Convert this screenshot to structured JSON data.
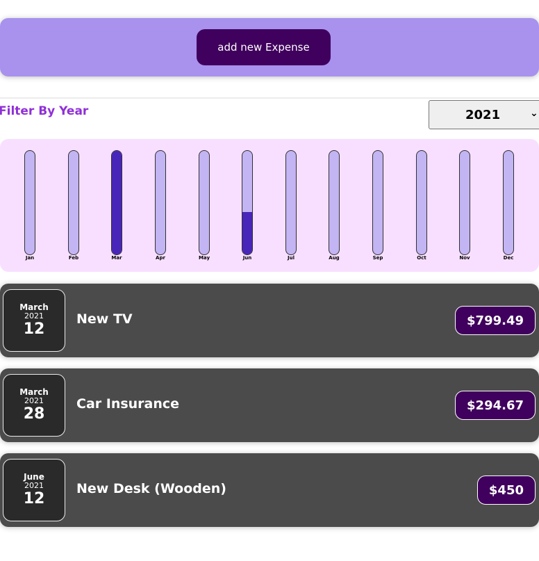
{
  "new_expense": {
    "button_label": "add new Expense"
  },
  "filter": {
    "label": "Filter By Year",
    "selected_year": "2021"
  },
  "chart_data": {
    "type": "bar",
    "categories": [
      "Jan",
      "Feb",
      "Mar",
      "Apr",
      "May",
      "Jun",
      "Jul",
      "Aug",
      "Sep",
      "Oct",
      "Nov",
      "Dec"
    ],
    "values": [
      0,
      0,
      1094.16,
      0,
      0,
      450,
      0,
      0,
      0,
      0,
      0,
      0
    ],
    "ylim": [
      0,
      1094.16
    ]
  },
  "expenses": [
    {
      "month": "March",
      "year": "2021",
      "day": "12",
      "title": "New TV",
      "amount": "$799.49"
    },
    {
      "month": "March",
      "year": "2021",
      "day": "28",
      "title": "Car Insurance",
      "amount": "$294.67"
    },
    {
      "month": "June",
      "year": "2021",
      "day": "12",
      "title": "New Desk (Wooden)",
      "amount": "$450"
    }
  ],
  "colors": {
    "accent": "#40005d",
    "filter_label": "#8f30d6",
    "bar_fill": "#4826b9",
    "bar_empty": "#c3b4f3"
  }
}
